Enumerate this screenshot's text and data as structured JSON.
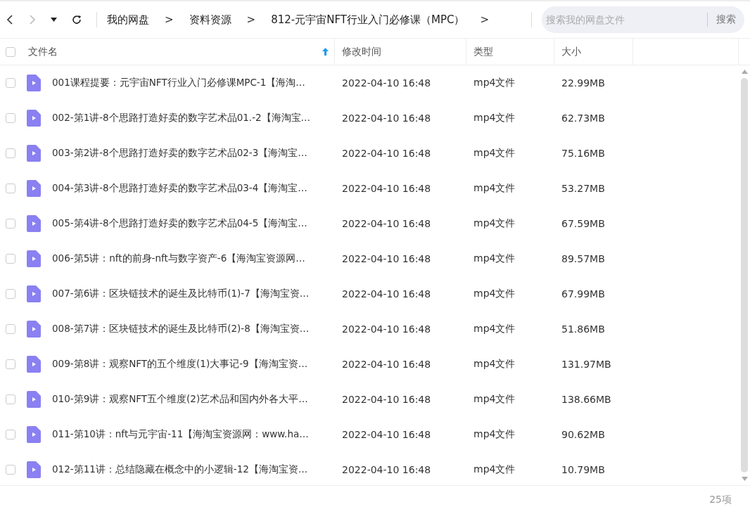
{
  "breadcrumb": [
    "我的网盘",
    "资料资源",
    "812-元宇宙NFT行业入门必修课（MPC）"
  ],
  "breadcrumb_separator": ">",
  "search": {
    "placeholder": "搜索我的网盘文件",
    "button": "搜索"
  },
  "table": {
    "select_all": {
      "checked": false
    },
    "columns": [
      {
        "label": "文件名",
        "sorted": true
      },
      {
        "label": "修改时间",
        "sorted": false
      },
      {
        "label": "类型",
        "sorted": false
      },
      {
        "label": "大小",
        "sorted": false
      }
    ],
    "rows": [
      {
        "checked": false,
        "name": "001课程提要：元宇宙NFT行业入门必修课MPC-1【海淘…",
        "modified": "2022-04-10 16:48",
        "type": "mp4文件",
        "size": "22.99MB"
      },
      {
        "checked": false,
        "name": "002-第1讲-8个思路打造好卖的数字艺术品01.-2【海淘宝…",
        "modified": "2022-04-10 16:48",
        "type": "mp4文件",
        "size": "62.73MB"
      },
      {
        "checked": false,
        "name": "003-第2讲-8个思路打造好卖的数字艺术品02-3【海淘宝…",
        "modified": "2022-04-10 16:48",
        "type": "mp4文件",
        "size": "75.16MB"
      },
      {
        "checked": false,
        "name": "004-第3讲-8个思路打造好卖的数字艺术品03-4【海淘宝…",
        "modified": "2022-04-10 16:48",
        "type": "mp4文件",
        "size": "53.27MB"
      },
      {
        "checked": false,
        "name": "005-第4讲-8个思路打造好卖的数字艺术品04-5【海淘宝…",
        "modified": "2022-04-10 16:48",
        "type": "mp4文件",
        "size": "67.59MB"
      },
      {
        "checked": false,
        "name": "006-第5讲：nft的前身-nft与数字资产-6【海淘宝资源网…",
        "modified": "2022-04-10 16:48",
        "type": "mp4文件",
        "size": "89.57MB"
      },
      {
        "checked": false,
        "name": "007-第6讲：区块链技术的诞生及比特币(1)-7【海淘宝资…",
        "modified": "2022-04-10 16:48",
        "type": "mp4文件",
        "size": "67.99MB"
      },
      {
        "checked": false,
        "name": "008-第7讲：区块链技术的诞生及比特币(2)-8【海淘宝资…",
        "modified": "2022-04-10 16:48",
        "type": "mp4文件",
        "size": "51.86MB"
      },
      {
        "checked": false,
        "name": "009-第8讲：观察NFT的五个维度(1)大事记-9【海淘宝资…",
        "modified": "2022-04-10 16:48",
        "type": "mp4文件",
        "size": "131.97MB"
      },
      {
        "checked": false,
        "name": "010-第9讲：观察NFT五个维度(2)艺术品和国内外各大平…",
        "modified": "2022-04-10 16:48",
        "type": "mp4文件",
        "size": "138.66MB"
      },
      {
        "checked": false,
        "name": "011-第10讲：nft与元宇宙-11【海淘宝资源网：www.ha…",
        "modified": "2022-04-10 16:48",
        "type": "mp4文件",
        "size": "90.62MB"
      },
      {
        "checked": false,
        "name": "012-第11讲：总结隐藏在概念中的小逻辑-12【海淘宝资…",
        "modified": "2022-04-10 16:48",
        "type": "mp4文件",
        "size": "10.79MB"
      }
    ]
  },
  "status_bar": {
    "count": "25项"
  }
}
